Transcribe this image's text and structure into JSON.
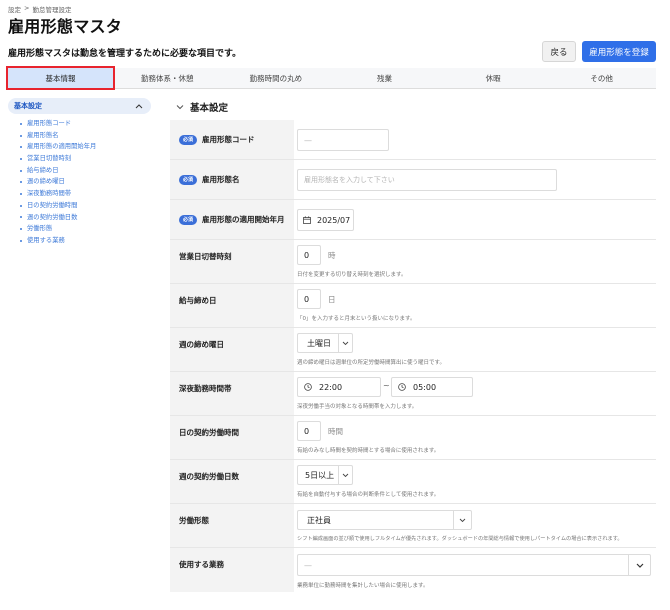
{
  "breadcrumb": [
    "設定",
    ">",
    "勤怠管理設定"
  ],
  "page": {
    "title": "雇用形態マスタ",
    "description": "雇用形態マスタは勤怠を管理するために必要な項目です。"
  },
  "actions": {
    "back": "戻る",
    "register": "雇用形態を登録"
  },
  "tabs": [
    "基本情報",
    "勤務体系・休憩",
    "勤務時間の丸め",
    "残業",
    "休暇",
    "その他"
  ],
  "sidebar": {
    "header": "基本設定",
    "items": [
      "雇用形態コード",
      "雇用形態名",
      "雇用形態の適用開始年月",
      "営業日切替時刻",
      "給与締め日",
      "週の締め曜日",
      "深夜勤務時間帯",
      "日の契約労働時間",
      "週の契約労働日数",
      "労働形態",
      "使用する業務"
    ]
  },
  "section": {
    "title": "基本設定"
  },
  "form": {
    "required_badge": "必須",
    "code": {
      "label": "雇用形態コード",
      "placeholder": "—"
    },
    "name": {
      "label": "雇用形態名",
      "placeholder": "雇用形態名を入力して下さい"
    },
    "start_month": {
      "label": "雇用形態の適用開始年月",
      "value": "2025/07"
    },
    "day_switch": {
      "label": "営業日切替時刻",
      "value": "0",
      "unit": "時",
      "help": "日付を変更する切り替え時刻を選択します。"
    },
    "pay_cutoff": {
      "label": "給与締め日",
      "value": "0",
      "unit": "日",
      "help": "「0」を入力すると月末という扱いになります。"
    },
    "week_cutoff": {
      "label": "週の締め曜日",
      "value": "土曜日",
      "help": "週の締め曜日は週単位の所定労働時間算出に使う曜日です。"
    },
    "night_hours": {
      "label": "深夜勤務時間帯",
      "start": "22:00",
      "separator": "~",
      "end": "05:00",
      "help": "深夜労働手当の対象となる時間帯を入力します。"
    },
    "daily_contract": {
      "label": "日の契約労働時間",
      "value": "0",
      "unit": "時間",
      "help": "有給のみなし時間を契約時間とする場合に使用されます。"
    },
    "weekly_days": {
      "label": "週の契約労働日数",
      "value": "5日以上",
      "help": "有給を自動付与する場合の判断条件として使用されます。"
    },
    "work_type": {
      "label": "労働形態",
      "value": "正社員",
      "help": "シフト編成画面の並び順で使用しフルタイムが優先されます。ダッシュボードの年間総与情報で使用しパートタイムの場合に表示されます。"
    },
    "business": {
      "label": "使用する業務",
      "placeholder": "—",
      "help": "業務単位に勤務時間を集計したい場合に使用します。"
    }
  }
}
